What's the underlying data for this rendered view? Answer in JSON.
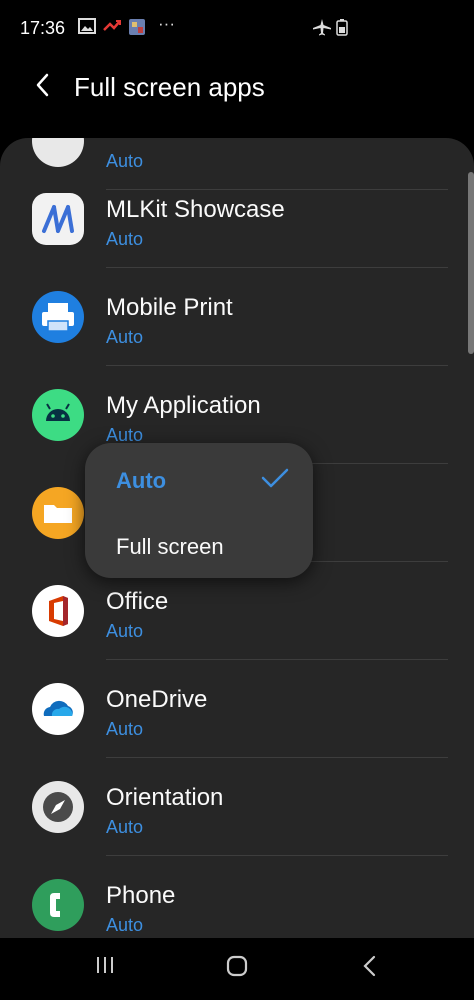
{
  "status_bar": {
    "time": "17:36",
    "more": "···"
  },
  "header": {
    "title": "Full screen apps"
  },
  "apps": [
    {
      "name": "",
      "status": "Auto"
    },
    {
      "name": "MLKit Showcase",
      "status": "Auto"
    },
    {
      "name": "Mobile Print",
      "status": "Auto"
    },
    {
      "name": "My Application",
      "status": "Auto"
    },
    {
      "name": "",
      "status": ""
    },
    {
      "name": "Office",
      "status": "Auto"
    },
    {
      "name": "OneDrive",
      "status": "Auto"
    },
    {
      "name": "Orientation",
      "status": "Auto"
    },
    {
      "name": "Phone",
      "status": "Auto"
    }
  ],
  "popup": {
    "options": [
      "Auto",
      "Full screen"
    ],
    "selected": "Auto"
  },
  "colors": {
    "accent": "#3d8fe0",
    "panel": "#262626",
    "popup": "#3a3a3a"
  }
}
